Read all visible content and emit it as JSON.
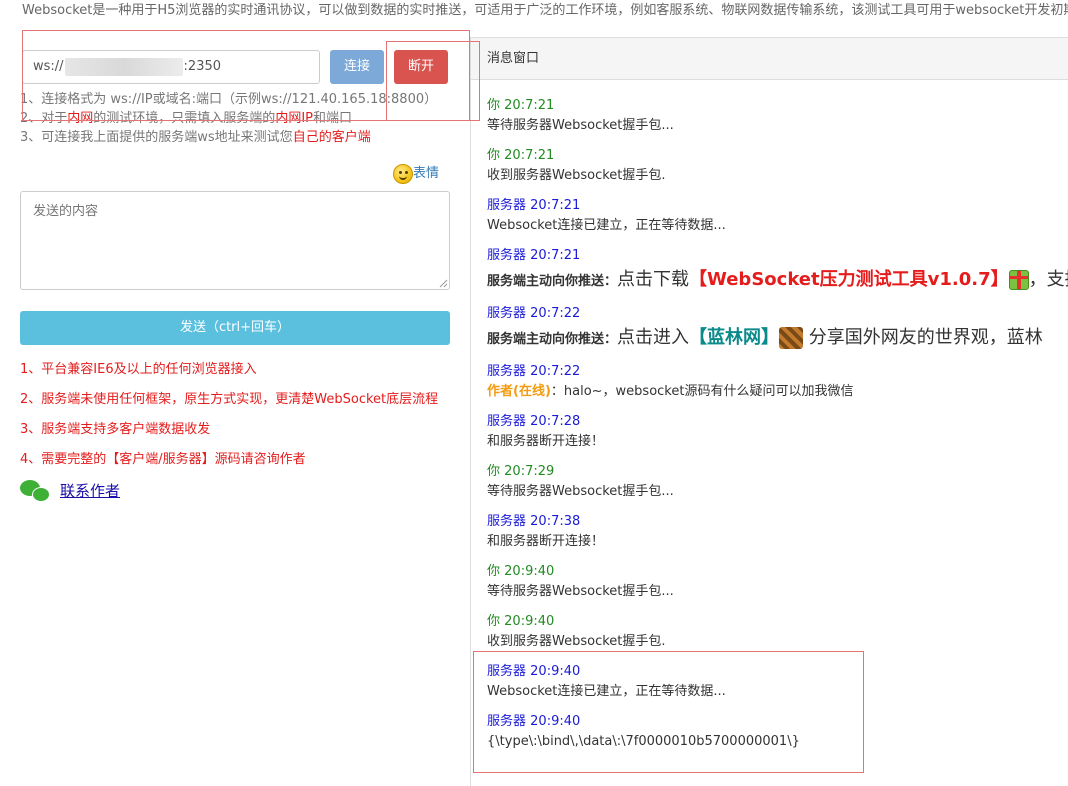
{
  "top_description": "Websocket是一种用于H5浏览器的实时通讯协议，可以做到数据的实时推送，可适用于广泛的工作环境，例如客服系统、物联网数据传输系统，该测试工具可用于websocket开发初期的测试工作",
  "connection": {
    "url_prefix": "ws://",
    "url_suffix": ":2350",
    "connect_label": "连接",
    "disconnect_label": "断开"
  },
  "tips": {
    "line1": "1、连接格式为 ws://IP或域名:端口（示例ws://121.40.165.18:8800）",
    "line2_a": "2、对于",
    "line2_red1": "内网",
    "line2_b": "的测试环境，只需填入服务端的",
    "line2_red2": "内网IP",
    "line2_c": "和端口",
    "line3_a": "3、可连接我上面提供的服务端ws地址来测试您",
    "line3_red": "自己的客户端"
  },
  "emoji": {
    "label": "表情",
    "icon": "smiley-icon"
  },
  "send": {
    "placeholder": "发送的内容",
    "button_label": "发送（ctrl+回车）"
  },
  "features": [
    "1、平台兼容IE6及以上的任何浏览器接入",
    "2、服务端未使用任何框架，原生方式实现，更清楚WebSocket底层流程",
    "3、服务端支持多客户端数据收发",
    "4、需要完整的【客户端/服务器】源码请咨询作者"
  ],
  "contact": {
    "label": "联系作者",
    "icon": "wechat-icon"
  },
  "messages_panel": {
    "title": "消息窗口",
    "messages": [
      {
        "sender": "你",
        "time": "20:7:21",
        "text": "等待服务器Websocket握手包..."
      },
      {
        "sender": "你",
        "time": "20:7:21",
        "text": "收到服务器Websocket握手包."
      },
      {
        "sender": "服务器",
        "time": "20:7:21",
        "text": "Websocket连接已建立，正在等待数据..."
      },
      {
        "sender": "服务器",
        "time": "20:7:21",
        "label": "服务端主动向你推送：",
        "text_a": "点击下载",
        "highlight": "【WebSocket压力测试工具v1.0.7】",
        "text_b": "，支持"
      },
      {
        "sender": "服务器",
        "time": "20:7:22",
        "label": "服务端主动向你推送：",
        "text_a": "点击进入",
        "highlight": "【蓝林网】",
        "text_b": "分享国外网友的世界观，蓝林"
      },
      {
        "sender": "服务器",
        "time": "20:7:22",
        "author": "作者(在线)",
        "text": "：halo~，websocket源码有什么疑问可以加我微信"
      },
      {
        "sender": "服务器",
        "time": "20:7:28",
        "text": "和服务器断开连接！"
      },
      {
        "sender": "你",
        "time": "20:7:29",
        "text": "等待服务器Websocket握手包..."
      },
      {
        "sender": "服务器",
        "time": "20:7:38",
        "text": "和服务器断开连接！"
      },
      {
        "sender": "你",
        "time": "20:9:40",
        "text": "等待服务器Websocket握手包..."
      },
      {
        "sender": "你",
        "time": "20:9:40",
        "text": "收到服务器Websocket握手包."
      },
      {
        "sender": "服务器",
        "time": "20:9:40",
        "text": "Websocket连接已建立，正在等待数据..."
      },
      {
        "sender": "服务器",
        "time": "20:9:40",
        "text": "{\\type\\:\\bind\\,\\data\\:\\7f0000010b5700000001\\}"
      }
    ]
  },
  "colors": {
    "connect_button": "#7da9d8",
    "disconnect_button": "#d9534f",
    "send_button": "#5bc0de",
    "highlight_red": "#e51c1c",
    "sender_you": "#228b22",
    "sender_server": "#1a1ad8",
    "annotation_box": "#e57373"
  }
}
